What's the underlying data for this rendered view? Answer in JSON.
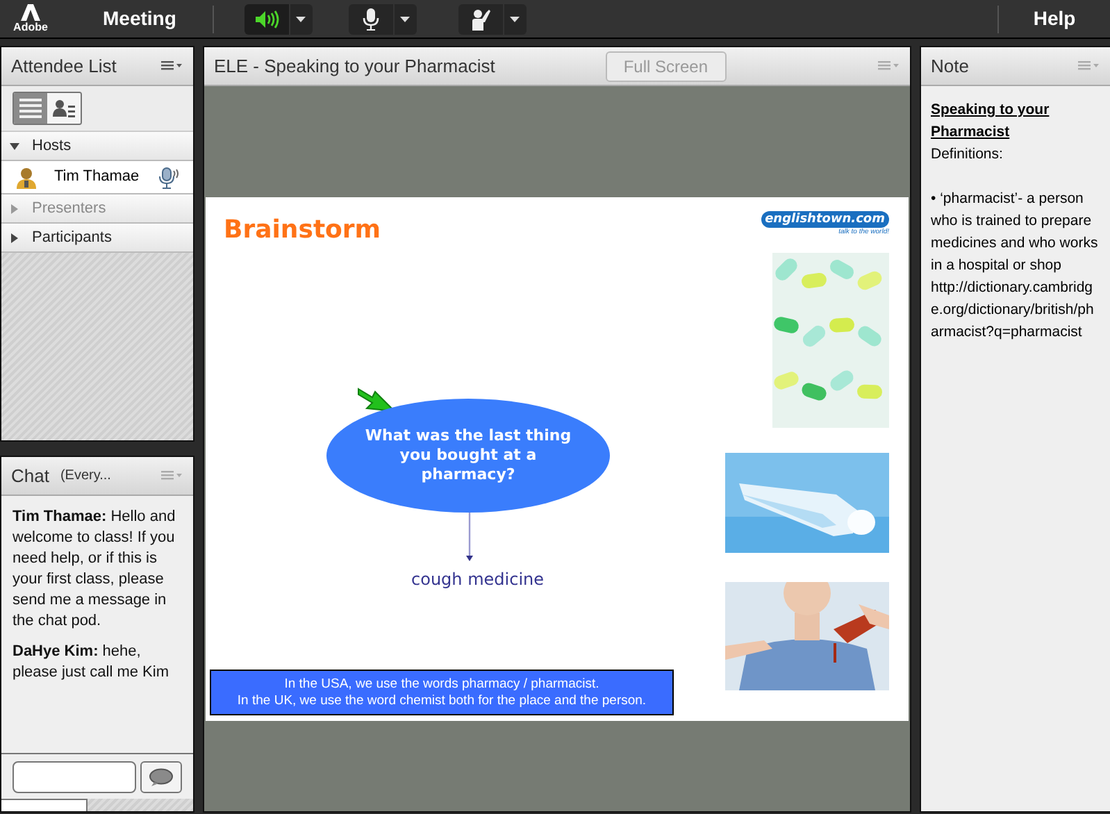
{
  "app": {
    "logo_text": "Adobe",
    "menu": [
      "Meeting"
    ],
    "help": "Help",
    "toolbar": [
      {
        "kind": "speaker",
        "on": true
      },
      {
        "kind": "mic",
        "on": false
      },
      {
        "kind": "status",
        "on": false
      }
    ]
  },
  "attendee_pod": {
    "title": "Attendee List",
    "views": [
      {
        "kind": "list",
        "selected": true
      },
      {
        "kind": "card",
        "selected": false
      }
    ],
    "groups": [
      {
        "label": "Hosts",
        "expanded": true,
        "disabled": false,
        "children": [
          {
            "name": "Tim Thamae"
          }
        ]
      },
      {
        "label": "Presenters",
        "expanded": false,
        "disabled": true
      },
      {
        "label": "Participants",
        "expanded": false,
        "disabled": false
      }
    ]
  },
  "chat_pod": {
    "title": "Chat",
    "recipient": "(Every...",
    "messages": [
      {
        "sender": "Tim Thamae:",
        "text": "Hello and welcome to class! If you need help, or if this is your first class, please send me a message in the chat pod."
      },
      {
        "sender": "DaHye Kim:",
        "text": "hehe, please just call me Kim"
      }
    ]
  },
  "share_pod": {
    "title": "ELE - Speaking to your Pharmacist",
    "full_screen": {
      "label": "Full Screen",
      "disabled": true
    },
    "slide": {
      "title": "Brainstorm",
      "logo": {
        "name": "englishtown.com",
        "tagline": "talk to the world!"
      },
      "question": "What was the last thing you bought at a pharmacy?",
      "answer": "cough medicine",
      "footnote": [
        "In the USA, we use the words pharmacy / pharmacist.",
        "In the UK, we use the word chemist both for the place and the person."
      ]
    }
  },
  "note_pod": {
    "title": "Note",
    "heading": "Speaking to your Pharmacist",
    "paragraphs": [
      "Definitions:",
      "• ‘pharmacist’- a person who is trained to prepare medicines and who works in a hospital or shop http://dictionary.cambridge.org/dictionary/british/pharmacist?q=pharmacist"
    ]
  }
}
